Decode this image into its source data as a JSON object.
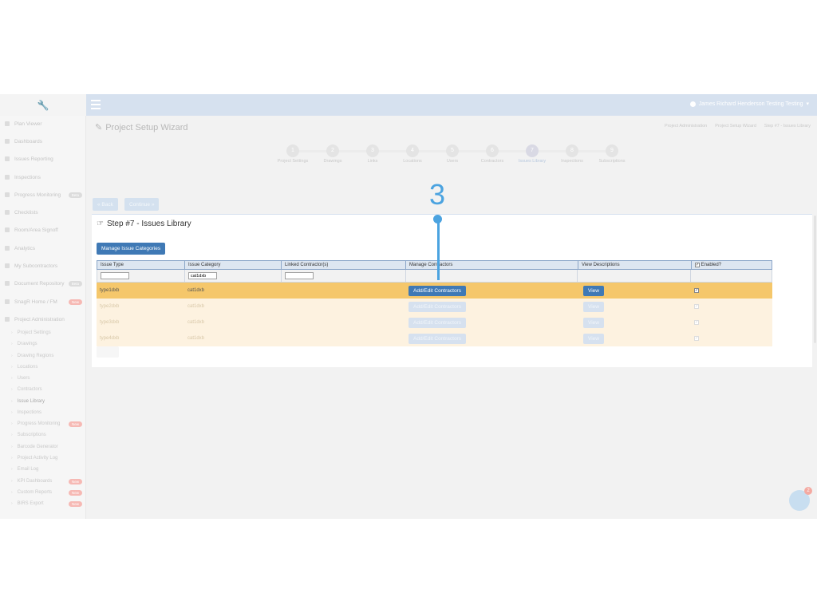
{
  "user": {
    "name": "James Richard Henderson Testing Testing"
  },
  "sidebar": {
    "items": [
      {
        "label": "Plan Viewer",
        "badge": ""
      },
      {
        "label": "Dashboards",
        "badge": ""
      },
      {
        "label": "Issues Reporting",
        "badge": ""
      },
      {
        "label": "Inspections",
        "badge": ""
      },
      {
        "label": "Progress Monitoring",
        "badge": "Beta"
      },
      {
        "label": "Checklists",
        "badge": ""
      },
      {
        "label": "Room/Area Signoff",
        "badge": ""
      },
      {
        "label": "Analytics",
        "badge": ""
      },
      {
        "label": "My Subcontractors",
        "badge": ""
      },
      {
        "label": "Document Repository",
        "badge": "Beta"
      },
      {
        "label": "SnagR Home / FM",
        "badge": "New"
      },
      {
        "label": "Project Administration",
        "badge": ""
      }
    ],
    "sub_items": [
      {
        "label": "Project Settings",
        "badge": ""
      },
      {
        "label": "Drawings",
        "badge": ""
      },
      {
        "label": "Drawing Regions",
        "badge": ""
      },
      {
        "label": "Locations",
        "badge": ""
      },
      {
        "label": "Users",
        "badge": ""
      },
      {
        "label": "Contractors",
        "badge": ""
      },
      {
        "label": "Issue Library",
        "badge": ""
      },
      {
        "label": "Inspections",
        "badge": ""
      },
      {
        "label": "Progress Monitoring",
        "badge": "New"
      },
      {
        "label": "Subscriptions",
        "badge": ""
      },
      {
        "label": "Barcode Generator",
        "badge": ""
      },
      {
        "label": "Project Activity Log",
        "badge": ""
      },
      {
        "label": "Email Log",
        "badge": ""
      },
      {
        "label": "KPI Dashboards",
        "badge": "New"
      },
      {
        "label": "Custom Reports",
        "badge": "New"
      },
      {
        "label": "BIRS Export",
        "badge": "New"
      }
    ]
  },
  "header": {
    "title": "Project Setup Wizard",
    "breadcrumbs": [
      "Project Administration",
      "Project Setup Wizard",
      "Step #7 - Issues Library"
    ]
  },
  "wizard": {
    "steps": [
      {
        "num": "1",
        "label": "Project Settings"
      },
      {
        "num": "2",
        "label": "Drawings"
      },
      {
        "num": "3",
        "label": "Links"
      },
      {
        "num": "4",
        "label": "Locations"
      },
      {
        "num": "5",
        "label": "Users"
      },
      {
        "num": "6",
        "label": "Contractors"
      },
      {
        "num": "7",
        "label": "Issues Library"
      },
      {
        "num": "8",
        "label": "Inspections"
      },
      {
        "num": "9",
        "label": "Subscriptions"
      }
    ],
    "back_label": "Back",
    "continue_label": "Continue"
  },
  "tutorial": {
    "step_number": "3"
  },
  "panel": {
    "title": "Step #7 - Issues Library",
    "manage_categories_label": "Manage Issue Categories"
  },
  "table": {
    "columns": [
      "Issue Type",
      "Issue Category",
      "Linked Contractor(s)",
      "Manage Contractors",
      "View Descriptions",
      "Enabled?"
    ],
    "filters": {
      "issue_type": "",
      "issue_category": "cat1dxb",
      "linked_contractors": ""
    },
    "edit_label": "Add/Edit Contractors",
    "view_label": "View",
    "rows": [
      {
        "type": "type1dxb",
        "category": "cat1dxb",
        "contractors": "",
        "enabled": "✓"
      },
      {
        "type": "type2dxb",
        "category": "cat1dxb",
        "contractors": "",
        "enabled": "✓"
      },
      {
        "type": "type3dxb",
        "category": "cat1dxb",
        "contractors": "",
        "enabled": "✓"
      },
      {
        "type": "type4dxb",
        "category": "cat1dxb",
        "contractors": "",
        "enabled": "✓"
      }
    ]
  },
  "chat": {
    "count": "2"
  },
  "colors": {
    "accent": "#3f79b5",
    "highlight": "#f5c76b",
    "tutorial": "#4ba3e0"
  }
}
